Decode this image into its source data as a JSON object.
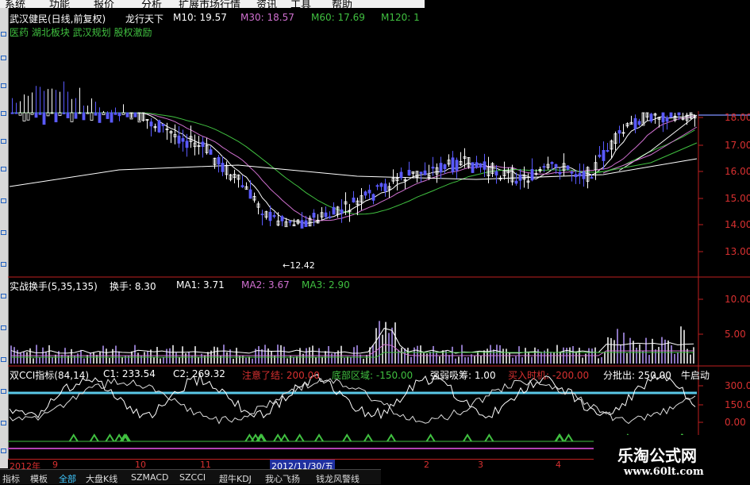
{
  "menu": [
    "系统",
    "功能",
    "报价",
    "分析",
    "扩展市场行情",
    "资讯",
    "工具",
    "帮助"
  ],
  "main_header": {
    "stock_label": "武汉健民(日线,前复权)",
    "slogan": "龙行天下",
    "ma10": "M10: 19.57",
    "ma30": "M30: 18.57",
    "ma60": "M60: 17.69",
    "ma120": "M120: 1",
    "tags": "医药 湖北板块 武汉规划 股权激励",
    "low_annotation": "←12.42"
  },
  "price_axis": [
    "18.00",
    "17.00",
    "16.00",
    "15.00",
    "14.00",
    "13.00"
  ],
  "volume_header": {
    "name": "实战换手(5,35,135)",
    "turnover": "换手: 8.30",
    "ma1": "MA1: 3.71",
    "ma2": "MA2: 3.67",
    "ma3": "MA3: 2.90"
  },
  "volume_axis": [
    "10.00",
    "5.00"
  ],
  "cci_header": {
    "name": "双CCI指标(84,14)",
    "c1": "C1: 233.54",
    "c2": "C2: 269.32",
    "notice": "注意了结: 200.00",
    "bottom": "底部区域: -150.00",
    "absorb": "强弱吸筹: 1.00",
    "buy": "买入时机: -200.00",
    "sell": "分批出: 250.00",
    "bull": "牛启动"
  },
  "cci_axis": [
    "300.0",
    "150.0",
    "0.00"
  ],
  "date_axis": [
    "2012年",
    "9",
    "10",
    "11",
    "2012/11/30/五",
    "2",
    "3",
    "4"
  ],
  "tabs": [
    "指标",
    "模板",
    "全部",
    "大盘K线",
    "SZMACD",
    "SZCCI",
    "超牛KDJ",
    "我心飞扬",
    "钱龙风警线"
  ],
  "watermark": {
    "title": "乐淘公式网",
    "url": "www.60lt.com"
  },
  "colors": {
    "up": "#ffffff",
    "down": "#5a5aff",
    "ma10": "#ffffff",
    "ma30": "#d070d0",
    "ma60": "#40c040",
    "ma120": "#ffffff",
    "axis": "#d83030",
    "cci_ref": "#5ac8e8",
    "cci_sig": "#40c040",
    "cci_sig2": "#b040b0"
  }
}
